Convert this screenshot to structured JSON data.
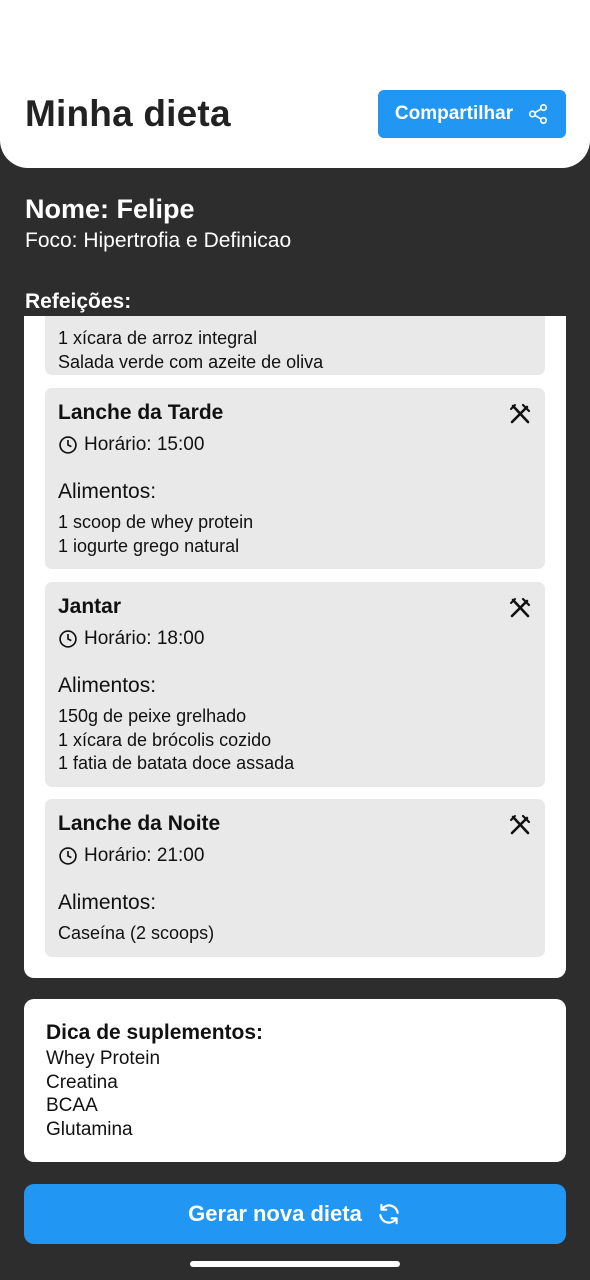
{
  "header": {
    "title": "Minha dieta",
    "share_label": "Compartilhar"
  },
  "profile": {
    "name": "Nome: Felipe",
    "focus": "Foco: Hipertrofia e Definicao"
  },
  "meals_label": "Refeições:",
  "partial_meal": {
    "foods": [
      "1 xícara de arroz integral",
      "Salada verde com azeite de oliva"
    ]
  },
  "meals": [
    {
      "title": "Lanche da Tarde",
      "time": "Horário: 15:00",
      "foods_label": "Alimentos:",
      "foods": [
        "1 scoop de whey protein",
        "1 iogurte grego natural"
      ]
    },
    {
      "title": "Jantar",
      "time": "Horário: 18:00",
      "foods_label": "Alimentos:",
      "foods": [
        "150g de peixe grelhado",
        "1 xícara de brócolis cozido",
        "1 fatia de batata doce assada"
      ]
    },
    {
      "title": "Lanche da Noite",
      "time": "Horário: 21:00",
      "foods_label": "Alimentos:",
      "foods": [
        "Caseína (2 scoops)"
      ]
    }
  ],
  "supplements": {
    "title": "Dica de suplementos:",
    "items": [
      "Whey Protein",
      "Creatina",
      "BCAA",
      "Glutamina"
    ]
  },
  "generate_label": "Gerar nova dieta",
  "icons": {
    "share": "share-icon",
    "meal": "fork-knife-icon",
    "clock": "clock-icon",
    "refresh": "refresh-icon"
  },
  "colors": {
    "accent": "#2196f3",
    "background": "#2d2d2d",
    "card": "#e9e9e9"
  }
}
